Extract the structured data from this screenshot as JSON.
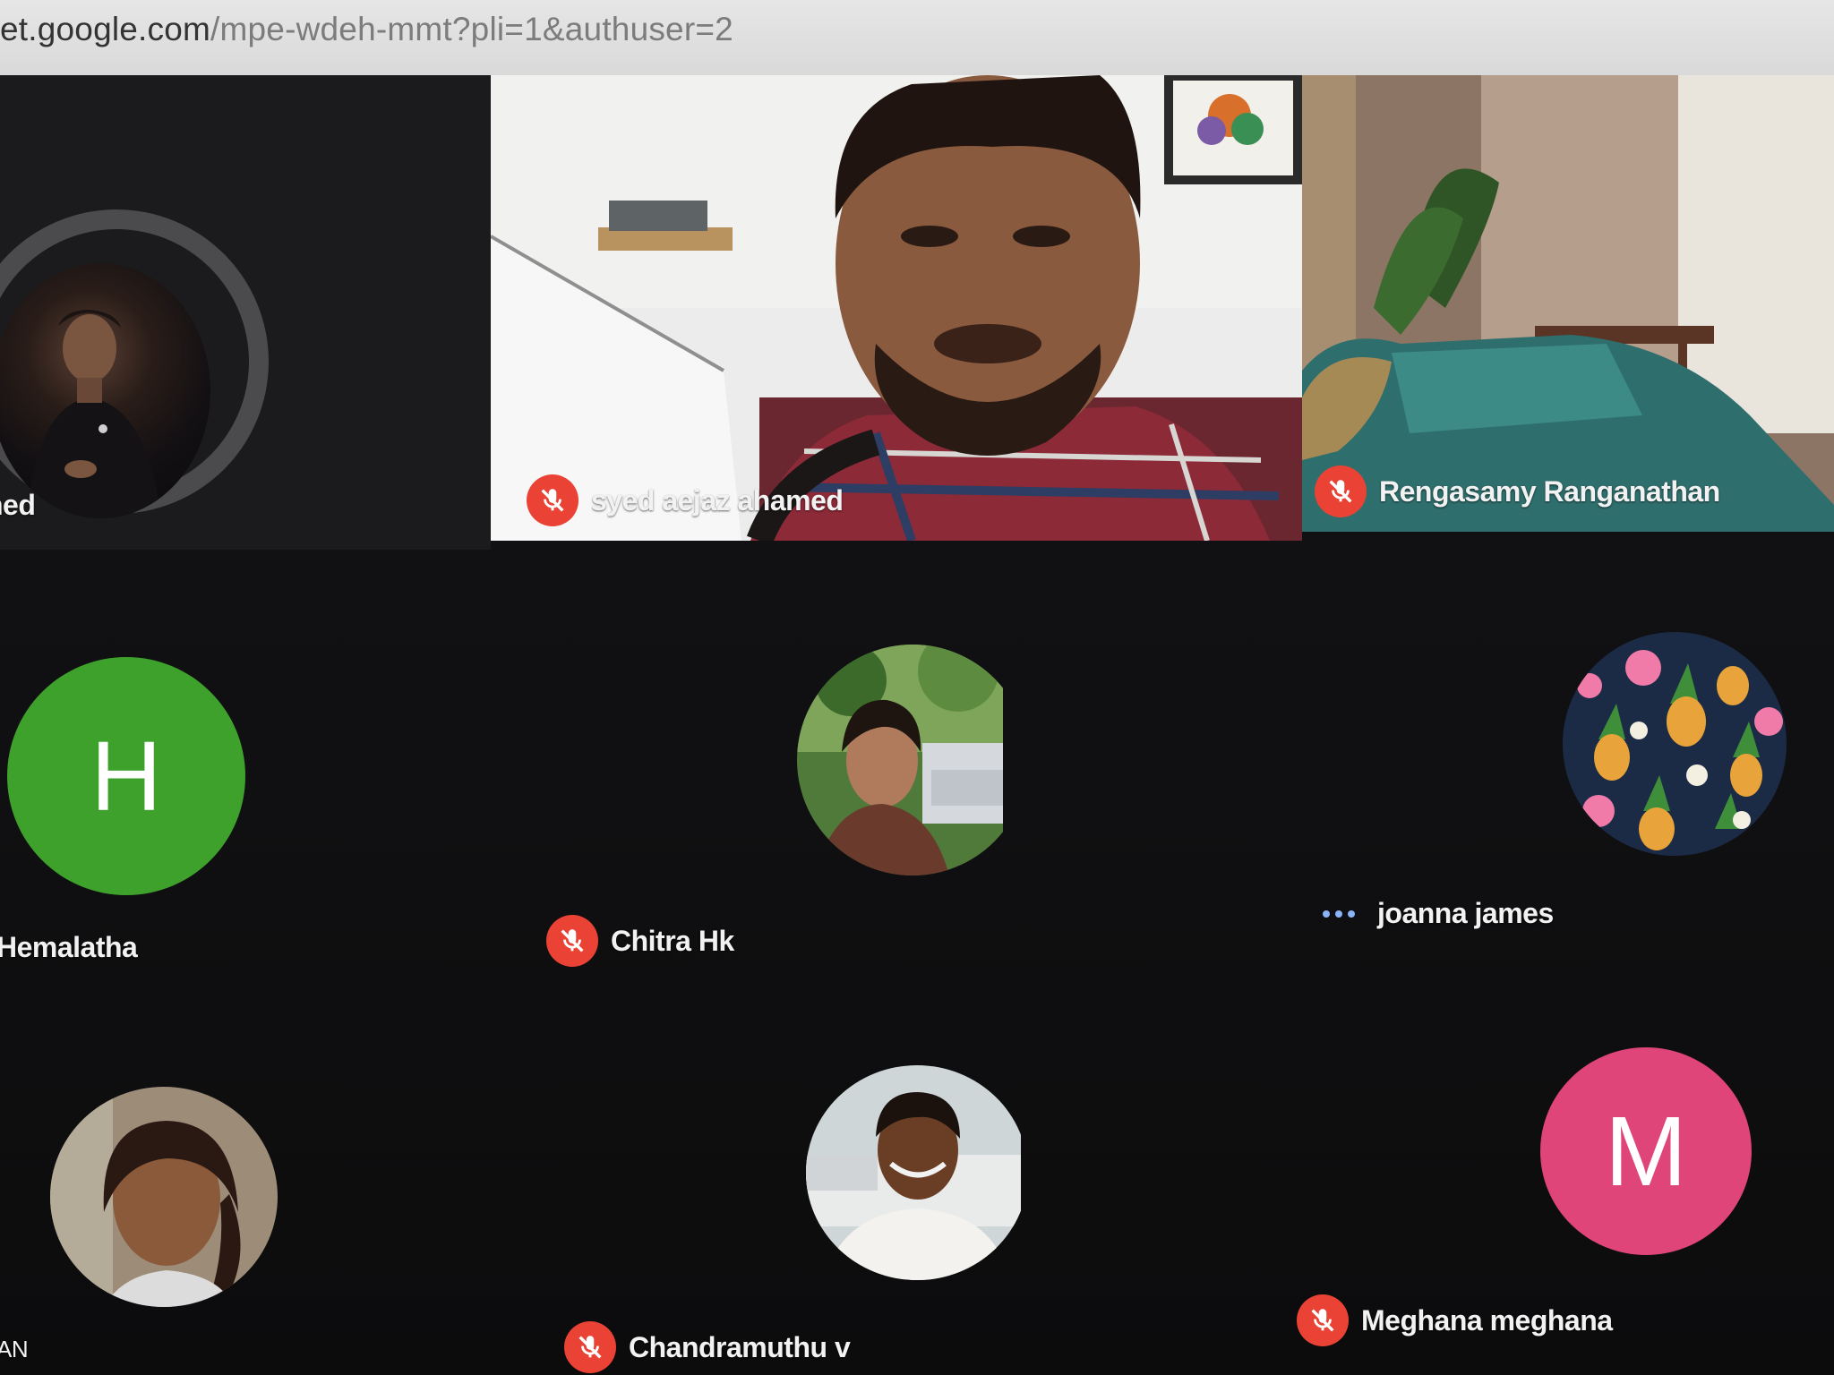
{
  "browser": {
    "url_host": "et.google.com",
    "url_path": "/mpe-wdeh-mmt?pli=1&authuser=2"
  },
  "participants": [
    {
      "name": "ned",
      "muted": false
    },
    {
      "name": "syed aejaz ahamed",
      "muted": true
    },
    {
      "name": "Rengasamy Ranganathan",
      "muted": true
    },
    {
      "name": "Hemalatha",
      "muted": false,
      "initial": "H"
    },
    {
      "name": "Chitra Hk",
      "muted": true
    },
    {
      "name": "joanna james",
      "muted": false,
      "status": "more"
    },
    {
      "name": "AN",
      "muted": false
    },
    {
      "name": "Chandramuthu v",
      "muted": true
    },
    {
      "name": "Meghana meghana",
      "muted": true,
      "initial": "M"
    }
  ],
  "colors": {
    "mute_badge": "#ea4335",
    "hemalatha_avatar": "#3ea12b",
    "meghana_avatar": "#e0457a",
    "dots": "#8ab4f8"
  },
  "icons": {
    "mute": "mic-off-icon",
    "more": "more-dots-icon"
  }
}
